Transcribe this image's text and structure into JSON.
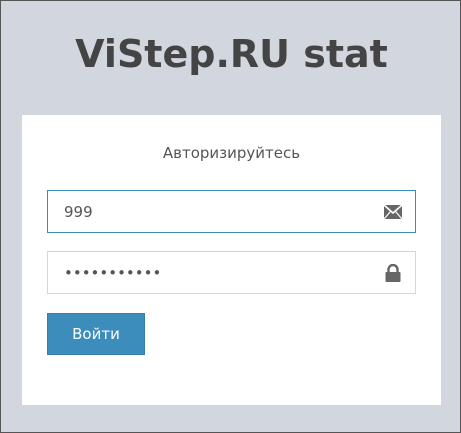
{
  "logo": {
    "text": "ViStep.RU stat"
  },
  "login_box": {
    "message": "Авторизируйтесь",
    "login_field": {
      "value": "999",
      "icon": "envelope-icon"
    },
    "password_field": {
      "value": "•••••••••••",
      "icon": "lock-icon"
    },
    "submit_label": "Войти"
  },
  "colors": {
    "page_background": "#d2d6de",
    "button": "#3c8dbc",
    "focus_border": "#3c8dbc",
    "icon": "#666666"
  }
}
